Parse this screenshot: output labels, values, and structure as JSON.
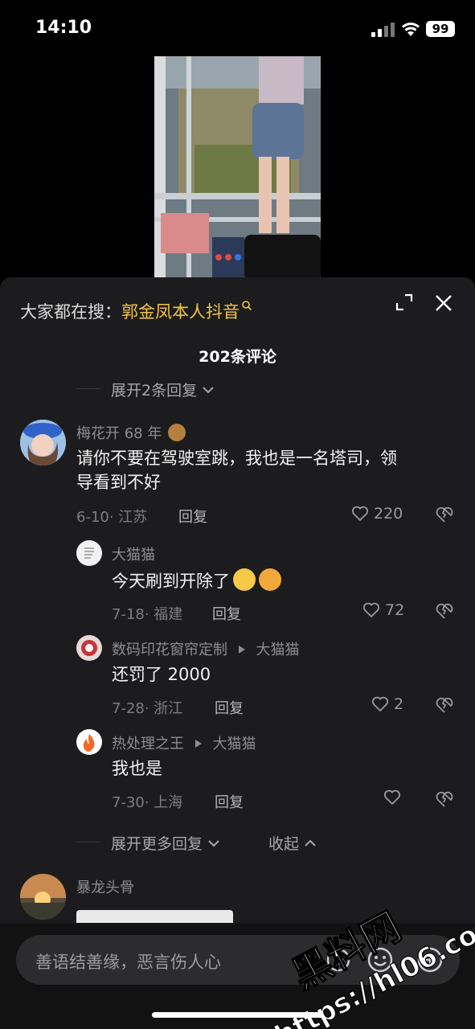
{
  "status_bar": {
    "time": "14:10",
    "battery": "99"
  },
  "sheet": {
    "hot_search_prefix": "大家都在搜：",
    "hot_search_keyword": "郭金凤本人抖音",
    "comment_count": "202条评论",
    "expand_top": "展开2条回复"
  },
  "comments": [
    {
      "name": "梅花开 68 年",
      "text_line1": "请你不要在驾驶室跳，我也是一名塔司，领",
      "text_line2": "导看到不好",
      "date_loc": "6-10· 江苏",
      "reply_label": "回复",
      "likes": "220"
    }
  ],
  "replies": [
    {
      "name": "大猫猫",
      "reply_to": "",
      "text": "今天刷到开除了",
      "date_loc": "7-18· 福建",
      "reply_label": "回复",
      "likes": "72"
    },
    {
      "name": "数码印花窗帘定制",
      "reply_to": "大猫猫",
      "text": "还罚了 2000",
      "date_loc": "7-28· 浙江",
      "reply_label": "回复",
      "likes": "2"
    },
    {
      "name": "热处理之王",
      "reply_to": "大猫猫",
      "text": "我也是",
      "date_loc": "7-30· 上海",
      "reply_label": "回复",
      "likes": ""
    }
  ],
  "expand_more": "展开更多回复",
  "collapse": "收起",
  "next_comment": {
    "name": "暴龙头骨"
  },
  "input": {
    "placeholder": "善语结善缘，恶言伤人心"
  },
  "watermark": {
    "line1": "黑料网",
    "line2": "https://hl06.co"
  },
  "colors": {
    "sheet_bg": "#1c1c1e",
    "keyword": "#f5c443",
    "text": "#f2f2f2",
    "muted": "#8d8d92"
  }
}
